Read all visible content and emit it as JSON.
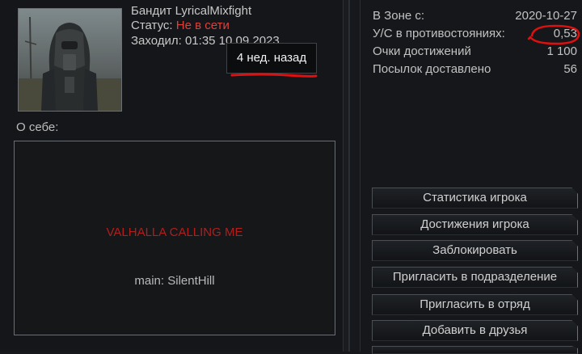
{
  "profile": {
    "name": "Бандит LyricalMixfight",
    "status_label": "Статус: ",
    "status_value": "Не в сети",
    "visited_text": "Заходил: 01:35 10.09.2023",
    "tooltip": "4 нед. назад"
  },
  "about": {
    "label": "О себе:",
    "line1": "VALHALLA CALLING ME",
    "line2": "main: SilentHill"
  },
  "stats": [
    {
      "label": "В Зоне с:",
      "value": "2020-10-27"
    },
    {
      "label": "У/С в противостояниях:",
      "value": "0,53"
    },
    {
      "label": "Очки достижений",
      "value": "1 100"
    },
    {
      "label": "Посылок доставлено",
      "value": "56"
    }
  ],
  "buttons": [
    {
      "label": "Статистика игрока"
    },
    {
      "label": "Достижения игрока"
    },
    {
      "label": "Заблокировать"
    },
    {
      "label": "Пригласить в подразделение"
    },
    {
      "label": "Пригласить в отряд"
    },
    {
      "label": "Добавить в друзья"
    }
  ],
  "colors": {
    "status_offline": "#e0403a",
    "about_accent": "#b11e1e",
    "annotation": "#e01010"
  }
}
